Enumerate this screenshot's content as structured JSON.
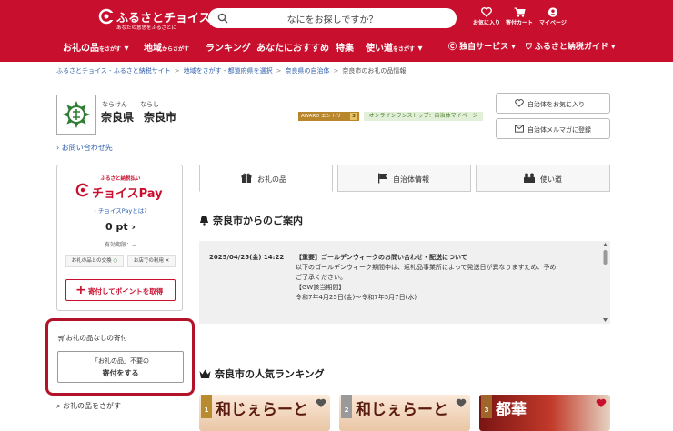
{
  "header": {
    "logo_text": "ふるさとチョイス",
    "logo_sub": "あなたの意思をふるさとに",
    "search_placeholder": "なにをお探しですか？",
    "icons": [
      {
        "label": "お気に入り",
        "icon": "heart-icon"
      },
      {
        "label": "寄付カート",
        "icon": "cart-icon"
      },
      {
        "label": "マイページ",
        "icon": "user-icon"
      }
    ],
    "nav": [
      {
        "label": "お礼の品",
        "small": "をさがす"
      },
      {
        "label": "地域",
        "small": "からさがす"
      },
      {
        "label": "ランキング",
        "small": ""
      },
      {
        "label": "あなたにおすすめ",
        "small": ""
      },
      {
        "label": "特集",
        "small": ""
      },
      {
        "label": "使い道",
        "small": "をさがす"
      },
      {
        "label": "独自サービス",
        "small": ""
      },
      {
        "label": "ふるさと納税ガイド",
        "small": ""
      }
    ]
  },
  "breadcrumb": [
    "ふるさとチョイス - ふるさと納税サイト",
    "地域をさがす - 都道府県を選択",
    "奈良県の自治体",
    "奈良市のお礼の品情報"
  ],
  "municipality": {
    "pref_ruby": "ならけん",
    "city_ruby": "ならし",
    "pref": "奈良県",
    "city": "奈良市",
    "award_badge": "AWARD エントリー",
    "award_count": "3",
    "onestop_badge": "オンラインワンストップ：自治体マイページ",
    "favorite_button": "自治体をお気に入り",
    "newsletter_button": "自治体メルマガに登録",
    "inquiry_link": "お問い合わせ先"
  },
  "choice_pay": {
    "heading": "ふるさと納税払い",
    "logo": "チョイスPay",
    "what_link": "チョイスPayとは?",
    "points": "0 pt",
    "expiry": "有効期限：−",
    "tag_exchange": "お礼の品との交換",
    "tag_store": "お店での利用",
    "donate_button": "寄付してポイントを取得"
  },
  "no_gift": {
    "title": "お礼の品なしの寄付",
    "button_line1": "「お礼の品」不要の",
    "button_line2": "寄付をする"
  },
  "search_gifts_label": "お礼の品をさがす",
  "tabs": [
    {
      "label": "お礼の品",
      "icon": "gift-icon",
      "active": true
    },
    {
      "label": "自治体情報",
      "icon": "flag-icon",
      "active": false
    },
    {
      "label": "使い道",
      "icon": "people-icon",
      "active": false
    }
  ],
  "notice_section": {
    "title": "奈良市からのご案内",
    "date": "2025/04/25(金) 14:22",
    "headline": "【重要】ゴールデンウィークのお問い合わせ・配送について",
    "lines": [
      "以下のゴールデンウィーク期間中は、返礼品事業所によって発送日が異なりますため、予め",
      "ご了承ください。",
      "【GW該当期間】",
      "令和7年4月25日(金)～令和7年5月7日(水)"
    ]
  },
  "ranking_section": {
    "title": "奈良市の人気ランキング",
    "items": [
      {
        "rank": "1",
        "label": "和じぇらーと"
      },
      {
        "rank": "2",
        "label": "和じぇらーと"
      },
      {
        "rank": "3",
        "label": "都華"
      }
    ]
  },
  "colors": {
    "brand": "#c8102e",
    "link": "#2a5caa",
    "highlight_border": "#b3132a"
  }
}
